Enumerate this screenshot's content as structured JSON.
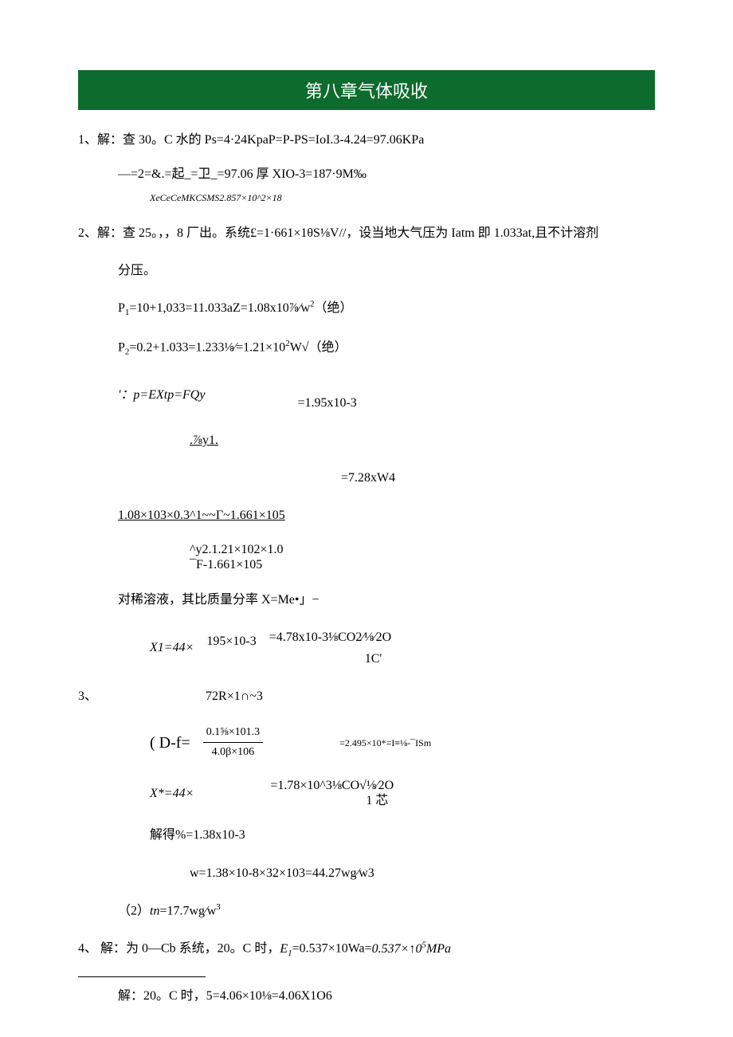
{
  "banner": "第八章气体吸收",
  "p1": "1、解：查 30。C 水的 Ps=4·24KpaP=P-PS=IoI.3-4.24=97.06KPa",
  "p1a": "—=2=&.=起_=卫_=97.06 厚 XIO-3=187·9M‰",
  "p1b": "XeCeCeMKCSMS2.857×10^2×18",
  "p2": "2、解：查 25。，，8 厂出。系统£=1·661×1θS⅛V//，设当地大气压为 Iatm 即 1.033at,且不计溶剂",
  "p2a": "分压。",
  "p2b": "P1=10+1,033=11.033aZ=1.08x10⅞⁄w2（绝）",
  "p2c": "P2=0.2+1.033=1.233⅛⁄=1.21×102W√（绝）",
  "p2d": "'：p=EXtp=FQy",
  "p2d_r": "=1.95x10-3",
  "p2e": ".⅞y1.",
  "p2e_r": "=7.28xW4",
  "p2f": "1.08×103×0.3^1~~Γ~1.661×105",
  "p2g": "^y2.1.21×102×1.0",
  "p2h": "¯F-1.661×105",
  "p2i": "对稀溶液，其比质量分率 X=Me•」−",
  "p2j_l": "X1=44×",
  "p2j_m": "195×10-3",
  "p2j_r": "=4.78x10-3⅛CO2⁄⅛⁄2O",
  "p2j_rb": "1C'",
  "p3": "3、",
  "p3a": "72R×1∩~3",
  "p3b_l": "( D-f=",
  "p3b_num": "0.1⅝×101.3",
  "p3b_den": "4.0β×106",
  "p3b_r": "=2.495×10*=I≡⅛-¯ISm",
  "p3c_l": "X*=44×",
  "p3c_r": "=1.78×10^3⅛CO√⅛⁄2O",
  "p3c_rb": "1 芯",
  "p3d": "解得%=1.38x10-3",
  "p3e": "w=1.38×10-8×32×103=44.27wg⁄w3",
  "p3f": "（2）tn=17.7wg⁄w3",
  "p4": "4、 解：为 0—Cb 系统，20。C 时，E1=0.537×10Wa=0.537×↑05MPa",
  "p4a": "解：20。C 时，5=4.06×10⅛=4.06X1O6"
}
